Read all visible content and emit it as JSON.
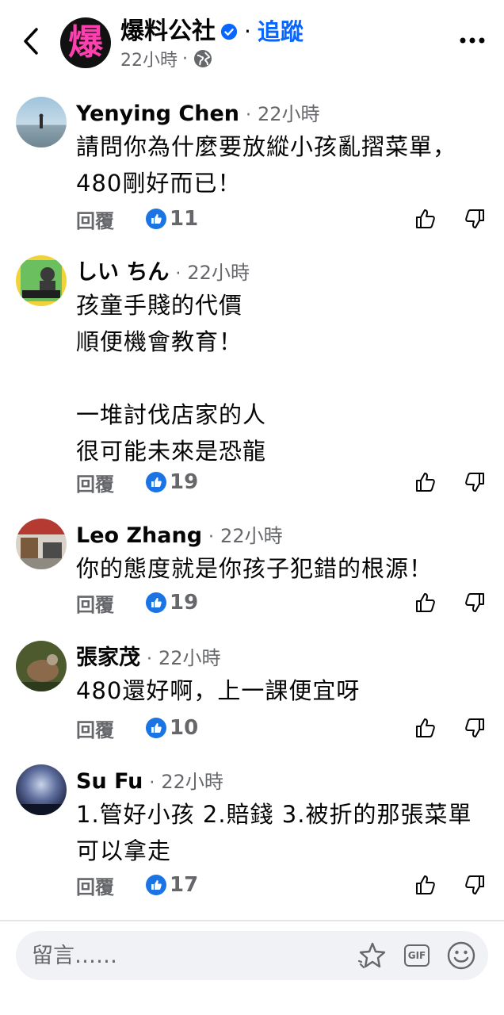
{
  "header": {
    "page_name": "爆料公社",
    "avatar_glyph": "爆",
    "separator": "·",
    "follow_label": "追蹤",
    "post_time": "22小時",
    "meta_separator": "·"
  },
  "comments": [
    {
      "name": "Yenying Chen",
      "time": "22小時",
      "text": "請問你為什麼要放縱小孩亂摺菜單，480剛好而已！",
      "reply_label": "回覆",
      "likes": "11"
    },
    {
      "name": "しい ちん",
      "time": "22小時",
      "text": "孩童手賤的代價\n順便機會教育！\n\n一堆討伐店家的人\n很可能未來是恐龍",
      "reply_label": "回覆",
      "likes": "19"
    },
    {
      "name": "Leo Zhang",
      "time": "22小時",
      "text": "你的態度就是你孩子犯錯的根源！",
      "reply_label": "回覆",
      "likes": "19"
    },
    {
      "name": "張家茂",
      "time": "22小時",
      "text": "480還好啊，上一課便宜呀",
      "reply_label": "回覆",
      "likes": "10"
    },
    {
      "name": "Su Fu",
      "time": "22小時",
      "text": "1.管好小孩 2.賠錢 3.被折的那張菜單可以拿走",
      "reply_label": "回覆",
      "likes": "17"
    }
  ],
  "composer": {
    "placeholder": "留言……"
  },
  "icons": {
    "back": "chevron-left-icon",
    "verified": "verified-badge-icon",
    "globe": "globe-icon",
    "more": "more-horizontal-icon",
    "like_badge": "like-icon",
    "thumbs_up": "thumbs-up-icon",
    "thumbs_down": "thumbs-down-icon",
    "sticker": "sticker-icon",
    "gif": "gif-icon",
    "emoji": "emoji-icon"
  },
  "colors": {
    "accent": "#0866ff",
    "like_blue": "#1b74e4",
    "secondary_text": "#65676b",
    "avatar_glyph": "#ff3fb0"
  }
}
